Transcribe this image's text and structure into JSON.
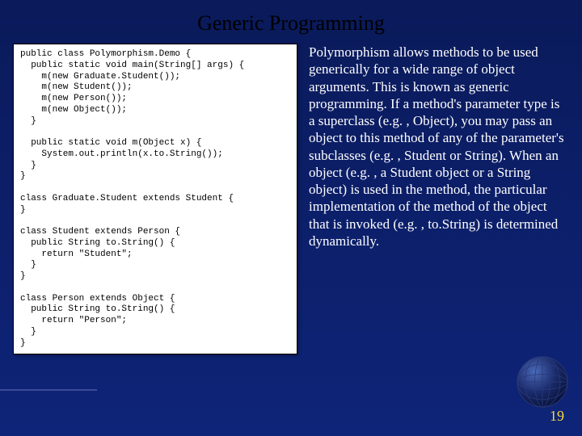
{
  "title": "Generic Programming",
  "code": "public class Polymorphism.Demo {\n  public static void main(String[] args) {\n    m(new Graduate.Student());\n    m(new Student());\n    m(new Person());\n    m(new Object());\n  }\n\n  public static void m(Object x) {\n    System.out.println(x.to.String());\n  }\n}\n\nclass Graduate.Student extends Student {\n}\n\nclass Student extends Person {\n  public String to.String() {\n    return \"Student\";\n  }\n}\n\nclass Person extends Object {\n  public String to.String() {\n    return \"Person\";\n  }\n}",
  "body": "Polymorphism allows methods to be used generically for a wide range of object arguments. This is known as generic programming. If a method's parameter type is a superclass (e.g. , Object), you may pass an object to this method of any of the parameter's subclasses (e.g. , Student or String). When an object (e.g. , a Student object or a String object) is used in the method, the particular implementation of the method of the object that is invoked (e.g. , to.String) is determined dynamically.",
  "page_number": "19"
}
